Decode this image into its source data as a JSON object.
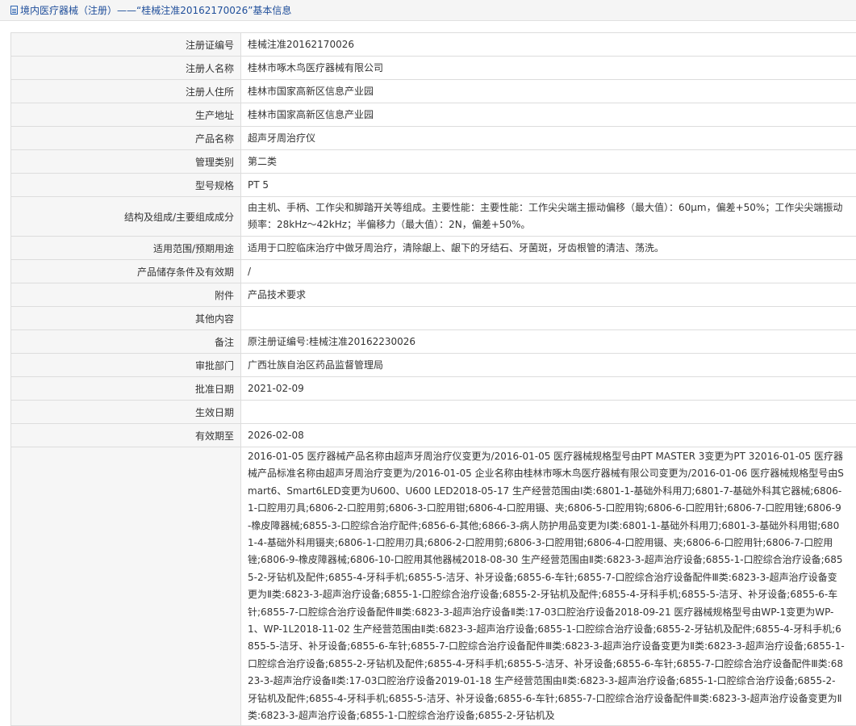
{
  "header": {
    "title": "境内医疗器械（注册）——“桂械注准20162170026”基本信息",
    "icon": "document-icon"
  },
  "rows": [
    {
      "label": "注册证编号",
      "value": "桂械注准20162170026"
    },
    {
      "label": "注册人名称",
      "value": "桂林市啄木鸟医疗器械有限公司"
    },
    {
      "label": "注册人住所",
      "value": "桂林市国家高新区信息产业园"
    },
    {
      "label": "生产地址",
      "value": "桂林市国家高新区信息产业园"
    },
    {
      "label": "产品名称",
      "value": "超声牙周治疗仪"
    },
    {
      "label": "管理类别",
      "value": "第二类"
    },
    {
      "label": "型号规格",
      "value": "PT 5"
    },
    {
      "label": "结构及组成/主要组成成分",
      "value": "由主机、手柄、工作尖和脚踏开关等组成。主要性能：主要性能：工作尖尖端主振动偏移（最大值）：60μm，偏差+50%；工作尖尖端振动频率：28kHz～42kHz；半偏移力（最大值）：2N，偏差+50%。"
    },
    {
      "label": "适用范围/预期用途",
      "value": "适用于口腔临床治疗中做牙周治疗，清除龈上、龈下的牙结石、牙菌斑，牙齿根管的清洁、荡洗。"
    },
    {
      "label": "产品储存条件及有效期",
      "value": "/"
    },
    {
      "label": "附件",
      "value": "产品技术要求"
    },
    {
      "label": "其他内容",
      "value": ""
    },
    {
      "label": "备注",
      "value": "原注册证编号:桂械注准20162230026"
    },
    {
      "label": "审批部门",
      "value": "广西壮族自治区药品监督管理局"
    },
    {
      "label": "批准日期",
      "value": "2021-02-09"
    },
    {
      "label": "生效日期",
      "value": ""
    },
    {
      "label": "有效期至",
      "value": "2026-02-08"
    },
    {
      "label": "",
      "value": "2016-01-05 医疗器械产品名称由超声牙周治疗仪变更为/2016-01-05 医疗器械规格型号由PT MASTER 3变更为PT 32016-01-05 医疗器械产品标准名称由超声牙周治疗变更为/2016-01-05 企业名称由桂林市啄木鸟医疗器械有限公司变更为/2016-01-06 医疗器械规格型号由Smart6、Smart6LED变更为U600、U600 LED2018-05-17 生产经营范围由Ⅰ类:6801-1-基础外科用刀;6801-7-基础外科其它器械;6806-1-口腔用刃具;6806-2-口腔用剪;6806-3-口腔用钳;6806-4-口腔用镊、夹;6806-5-口腔用钩;6806-6-口腔用针;6806-7-口腔用锉;6806-9-橡皮障器械;6855-3-口腔综合治疗配件;6856-6-其他;6866-3-病人防护用品变更为Ⅰ类:6801-1-基础外科用刀;6801-3-基础外科用钳;6801-4-基础外科用镊夹;6806-1-口腔用刃具;6806-2-口腔用剪;6806-3-口腔用钳;6806-4-口腔用镊、夹;6806-6-口腔用针;6806-7-口腔用锉;6806-9-橡皮障器械;6806-10-口腔用其他器械2018-08-30 生产经营范围由Ⅱ类:6823-3-超声治疗设备;6855-1-口腔综合治疗设备;6855-2-牙钻机及配件;6855-4-牙科手机;6855-5-洁牙、补牙设备;6855-6-车针;6855-7-口腔综合治疗设备配件Ⅲ类:6823-3-超声治疗设备变更为Ⅱ类:6823-3-超声治疗设备;6855-1-口腔综合治疗设备;6855-2-牙钻机及配件;6855-4-牙科手机;6855-5-洁牙、补牙设备;6855-6-车针;6855-7-口腔综合治疗设备配件Ⅲ类:6823-3-超声治疗设备Ⅱ类:17-03口腔治疗设备2018-09-21 医疗器械规格型号由WP-1变更为WP-1、WP-1L2018-11-02 生产经营范围由Ⅱ类:6823-3-超声治疗设备;6855-1-口腔综合治疗设备;6855-2-牙钻机及配件;6855-4-牙科手机;6855-5-洁牙、补牙设备;6855-6-车针;6855-7-口腔综合治疗设备配件Ⅲ类:6823-3-超声治疗设备变更为Ⅱ类:6823-3-超声治疗设备;6855-1-口腔综合治疗设备;6855-2-牙钻机及配件;6855-4-牙科手机;6855-5-洁牙、补牙设备;6855-6-车针;6855-7-口腔综合治疗设备配件Ⅲ类:6823-3-超声治疗设备Ⅱ类:17-03口腔治疗设备2019-01-18 生产经营范围由Ⅱ类:6823-3-超声治疗设备;6855-1-口腔综合治疗设备;6855-2-牙钻机及配件;6855-4-牙科手机;6855-5-洁牙、补牙设备;6855-6-车针;6855-7-口腔综合治疗设备配件Ⅲ类:6823-3-超声治疗设备变更为Ⅱ类:6823-3-超声治疗设备;6855-1-口腔综合治疗设备;6855-2-牙钻机及"
    }
  ]
}
